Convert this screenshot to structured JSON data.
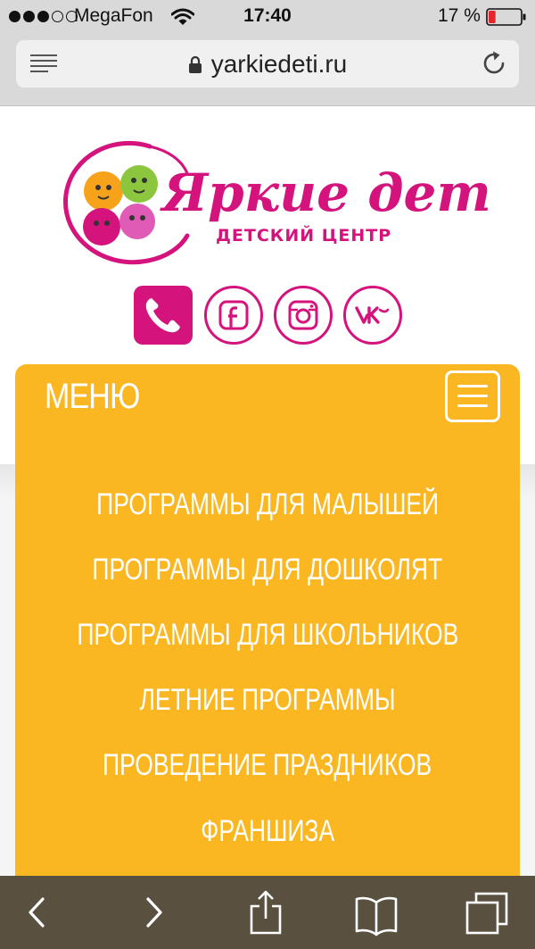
{
  "status_bar": {
    "carrier": "MegaFon",
    "time": "17:40",
    "battery_percent": "17 %",
    "battery_level": 0.17,
    "signal_bars_filled": 3,
    "signal_bars_total": 5
  },
  "address_bar": {
    "url": "yarkiedeti.ru"
  },
  "logo": {
    "title": "Яркие дети",
    "subtitle": "ДЕТСКИЙ ЦЕНТР"
  },
  "social": {
    "icons": [
      "phone-icon",
      "facebook-icon",
      "instagram-icon",
      "vk-icon"
    ]
  },
  "menu": {
    "title": "МЕНЮ",
    "items": [
      "ПРОГРАММЫ ДЛЯ МАЛЫШЕЙ",
      "ПРОГРАММЫ ДЛЯ ДОШКОЛЯТ",
      "ПРОГРАММЫ ДЛЯ ШКОЛЬНИКОВ",
      "ЛЕТНИЕ ПРОГРАММЫ",
      "ПРОВЕДЕНИЕ ПРАЗДНИКОВ",
      "ФРАНШИЗА"
    ]
  },
  "colors": {
    "brand_pink": "#d4137d",
    "menu_orange": "#fbb722",
    "toolbar": "#5a5040"
  }
}
